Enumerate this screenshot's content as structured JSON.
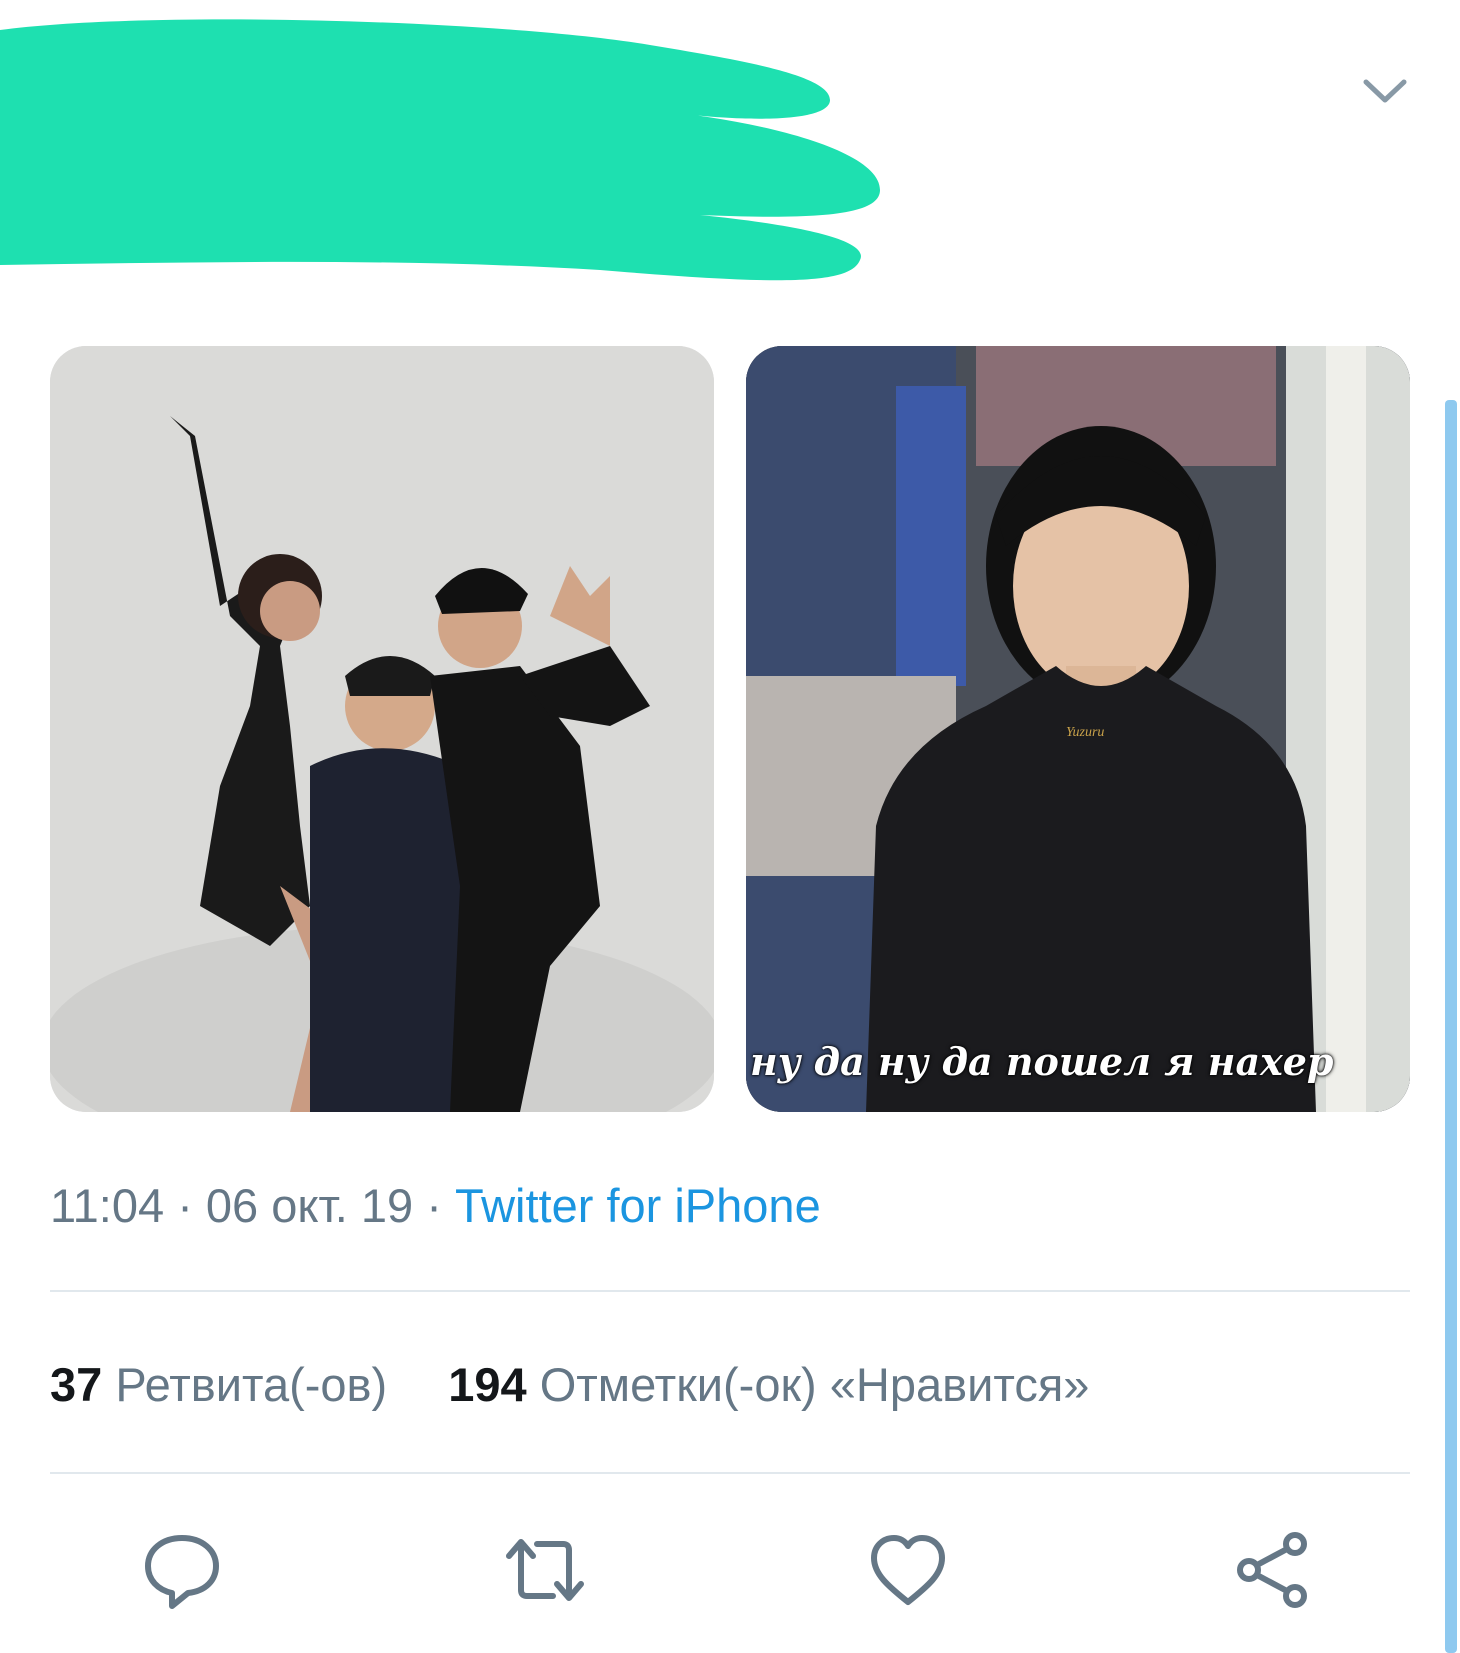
{
  "colors": {
    "redaction": "#1ee0b0",
    "meta_gray": "#657786",
    "link_blue": "#1b95e0",
    "icon_gray": "#657786",
    "divider": "#e1e8ed"
  },
  "header": {
    "menu_icon": "chevron-down-icon"
  },
  "media": {
    "left_image": {
      "description_icon": "photo"
    },
    "right_image": {
      "caption": "ну да ну да пошел я нахер"
    }
  },
  "meta": {
    "time": "11:04",
    "separator": " · ",
    "date": "06 окт. 19",
    "source": "Twitter for iPhone"
  },
  "stats": {
    "retweets_count": "37",
    "retweets_label": "Ретвита(-ов)",
    "likes_count": "194",
    "likes_label": "Отметки(-ок) «Нравится»"
  },
  "actions": {
    "reply_icon": "reply-icon",
    "retweet_icon": "retweet-icon",
    "like_icon": "heart-icon",
    "share_icon": "share-icon"
  }
}
